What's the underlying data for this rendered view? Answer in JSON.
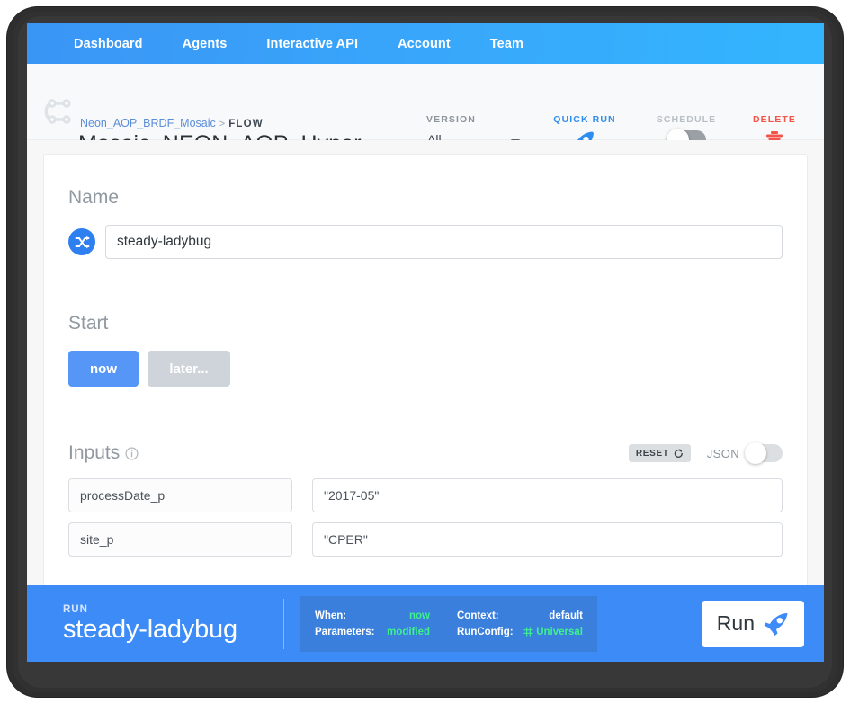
{
  "nav": {
    "items": [
      {
        "label": "Dashboard"
      },
      {
        "label": "Agents"
      },
      {
        "label": "Interactive API"
      },
      {
        "label": "Account"
      },
      {
        "label": "Team"
      }
    ]
  },
  "header": {
    "breadcrumb_project": "Neon_AOP_BRDF_Mosaic",
    "breadcrumb_separator": ">",
    "breadcrumb_kind": "FLOW",
    "title": "Mosaic_NEON_AOP_Hyper",
    "flow_icon": "flow-graph-icon",
    "version": {
      "label": "VERSION",
      "value": "All",
      "icon": "chevron-down-icon"
    },
    "quick_run": {
      "label": "QUICK RUN",
      "icon": "rocket-bolt-icon"
    },
    "schedule": {
      "label": "SCHEDULE",
      "state": "off",
      "icon": "toggle-switch-icon"
    },
    "delete": {
      "label": "DELETE",
      "icon": "trash-icon"
    }
  },
  "main": {
    "name_section": {
      "title": "Name",
      "shuffle_icon": "shuffle-icon",
      "value": "steady-ladybug",
      "placeholder": "Name"
    },
    "start_section": {
      "title": "Start",
      "options": [
        {
          "label": "now",
          "selected": true
        },
        {
          "label": "later...",
          "selected": false
        }
      ]
    },
    "inputs_section": {
      "title": "Inputs",
      "info_icon": "info-icon",
      "reset_label": "RESET",
      "reset_icon": "refresh-icon",
      "json_label": "JSON",
      "json_state": "off",
      "rows": [
        {
          "key": "processDate_p",
          "value": "\"2017-05\""
        },
        {
          "key": "site_p",
          "value": "\"CPER\""
        }
      ]
    }
  },
  "runbar": {
    "kicker": "RUN",
    "name": "steady-ladybug",
    "summary": {
      "when_label": "When:",
      "when_value": "now",
      "parameters_label": "Parameters:",
      "parameters_value": "modified",
      "context_label": "Context:",
      "context_value": "default",
      "runconfig_label": "RunConfig:",
      "runconfig_value": "Universal",
      "runconfig_icon": "server-icon"
    },
    "run_button": {
      "label": "Run",
      "icon": "rocket-icon"
    }
  },
  "colors": {
    "nav_blue": "#38a8fb",
    "accent_blue": "#3d8bf7",
    "green": "#3ef08e",
    "danger_red": "#f4554a",
    "muted_gray": "#9098a0"
  }
}
